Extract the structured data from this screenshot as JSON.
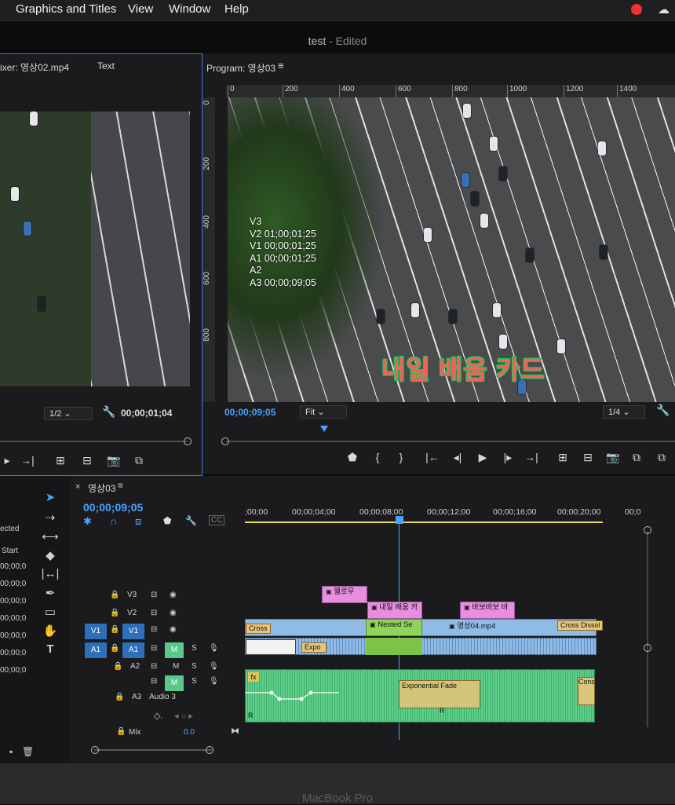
{
  "menubar": {
    "items": [
      "Graphics and Titles",
      "View",
      "Window",
      "Help"
    ]
  },
  "window": {
    "title": "test",
    "status": " - Edited"
  },
  "source_monitor": {
    "tab_label": "ixer: 영상02.mp4",
    "tab2_label": "Text",
    "resolution": "1/2",
    "timecode": "00;00;01;04"
  },
  "program_monitor": {
    "tab_label": "Program: 영상03",
    "ruler_h": [
      "0",
      "200",
      "400",
      "600",
      "800",
      "1000",
      "1200",
      "1400"
    ],
    "ruler_v": [
      "0",
      "200",
      "400",
      "600",
      "800"
    ],
    "overlay_lines": [
      "V3",
      "V2 01;00;01;25",
      "V1 00;00;01;25",
      "A1 00;00;01;25",
      "A2",
      "A3 00;00;09;05"
    ],
    "title_text": "내일 배움 카드",
    "timecode": "00;00;09;05",
    "zoom": "Fit",
    "resolution": "1/4"
  },
  "project_panel": {
    "labels": [
      "ected",
      "Start",
      "00;00;0",
      "00;00;0",
      "00;00;0",
      "00;00;0",
      "00;00;0",
      "00;00;0",
      "00;00;0"
    ]
  },
  "timeline": {
    "sequence_name": "영상03",
    "timecode": "00;00;09;05",
    "ruler_labels": [
      ";00;00",
      "00;00;04;00",
      "00;00;08;00",
      "00;00;12;00",
      "00;00;16;00",
      "00;00;20;00",
      "00;0"
    ],
    "tracks": {
      "v3": "V3",
      "v2": "V2",
      "v1_source": "V1",
      "v1": "V1",
      "a1_source": "A1",
      "a1": "A1",
      "a2": "A2",
      "a3": "A3",
      "a3_name": "Audio 3",
      "mute": "M",
      "solo": "S",
      "mix_label": "Mix",
      "mix_value": "0.0"
    },
    "clips": {
      "v3_title": "헬로우",
      "v2_title1": "내일 배움 카",
      "v2_title2": "바보바보 바",
      "v1_cross": "Cross",
      "v1_nested": "Nested Se",
      "v1_clip": "영상04.mp4",
      "v1_dissolve": "Cross Dissol",
      "a1_expo": "Expo",
      "a3_fx": "fx",
      "a3_fade": "Exponential Fade",
      "a3_cons": "Cons",
      "a3_r": "R",
      "a3_r2": "R"
    }
  },
  "laptop": {
    "label": "MacBook Pro"
  },
  "colors": {
    "accent_blue": "#4aa3ff",
    "title_clip": "#e78ee0",
    "video_clip": "#8fbbe6",
    "audio_clip": "#5fd08a",
    "nested_clip": "#8fd35a"
  }
}
